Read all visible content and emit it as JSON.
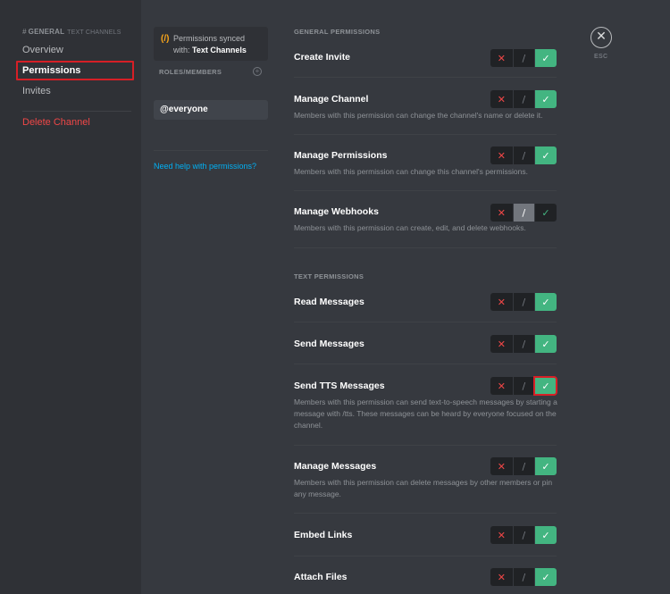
{
  "sidebar": {
    "category": {
      "name": "GENERAL",
      "sub": "TEXT CHANNELS"
    },
    "items": [
      {
        "label": "Overview"
      },
      {
        "label": "Permissions"
      },
      {
        "label": "Invites"
      },
      {
        "label": "Delete Channel"
      }
    ]
  },
  "roles": {
    "sync_icon": "(/)",
    "sync_text_1": "Permissions synced",
    "sync_text_2_prefix": "with:",
    "sync_text_2_channel": "Text Channels",
    "header": "ROLES/MEMBERS",
    "add_icon": "+",
    "role": "@everyone",
    "help_link": "Need help with permissions?"
  },
  "sections": [
    {
      "title": "GENERAL PERMISSIONS",
      "perms": [
        {
          "name": "Create Invite",
          "desc": "",
          "state": "allow"
        },
        {
          "name": "Manage Channel",
          "desc": "Members with this permission can change the channel's name or delete it.",
          "state": "allow"
        },
        {
          "name": "Manage Permissions",
          "desc": "Members with this permission can change this channel's permissions.",
          "state": "allow"
        },
        {
          "name": "Manage Webhooks",
          "desc": "Members with this permission can create, edit, and delete webhooks.",
          "state": "neutral"
        }
      ]
    },
    {
      "title": "TEXT PERMISSIONS",
      "perms": [
        {
          "name": "Read Messages",
          "desc": "",
          "state": "allow"
        },
        {
          "name": "Send Messages",
          "desc": "",
          "state": "allow"
        },
        {
          "name": "Send TTS Messages",
          "desc": "Members with this permission can send text-to-speech messages by starting a message with /tts. These messages can be heard by everyone focused on the channel.",
          "state": "allow"
        },
        {
          "name": "Manage Messages",
          "desc": "Members with this permission can delete messages by other members or pin any message.",
          "state": "allow"
        },
        {
          "name": "Embed Links",
          "desc": "",
          "state": "allow"
        },
        {
          "name": "Attach Files",
          "desc": "",
          "state": "allow"
        }
      ]
    }
  ],
  "toggle_glyphs": {
    "deny": "✕",
    "neutral": "/",
    "allow": "✓"
  },
  "esc": {
    "icon": "✕",
    "label": "ESC"
  },
  "colors": {
    "background": "#36393f",
    "sidebar": "#2f3136",
    "allow": "#43b581",
    "deny": "#f04747",
    "link": "#00b0f4",
    "highlight": "#d61f26"
  }
}
